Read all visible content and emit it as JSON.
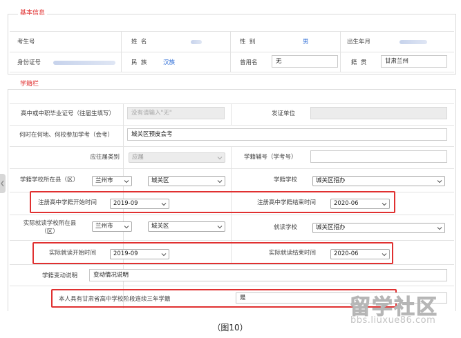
{
  "basic_info": {
    "legend": "基本信息",
    "exam_no_label": "考生号",
    "name_label": "姓  名",
    "gender_label": "性  别",
    "gender_value": "男",
    "birth_label": "出生年月",
    "id_label": "身份证号",
    "ethnicity_label": "民  族",
    "ethnicity_value": "汉族",
    "former_name_label": "曾用名",
    "former_name_value": "无",
    "native_place_label": "籍  贯",
    "native_place_value": "甘肃兰州"
  },
  "school_roll": {
    "legend": "学籍栏",
    "cert_no_label": "高中或中职毕业证号（往届生填写）",
    "cert_no_placeholder": "没有请输入\"无\"",
    "issuer_label": "发证单位",
    "exam_when_where_label": "何时在何地、何校参加学考（会考）",
    "exam_when_where_value": "城关区预皮会考",
    "grad_type_label": "应往届类别",
    "grad_type_value": "应届",
    "roll_no_label": "学籍辅号（学考号）",
    "roll_county_label": "学籍学校所在县（区）",
    "roll_city_value": "兰州市",
    "roll_district_value": "城关区",
    "roll_school_label": "学籍学校",
    "roll_school_value": "城关区招办",
    "reg_start_label": "注册高中学籍开始时间",
    "reg_start_value": "2019-09",
    "reg_end_label": "注册高中学籍结束时间",
    "reg_end_value": "2020-06",
    "actual_county_label": "实际就读学校所在县（区）",
    "actual_city_value": "兰州市",
    "actual_district_value": "城关区",
    "actual_school_label": "就读学校",
    "actual_school_value": "城关区招办",
    "actual_start_label": "实际就读开始时间",
    "actual_start_value": "2019-09",
    "actual_end_label": "实际就读结束时间",
    "actual_end_value": "2020-06",
    "change_label": "学籍变动说明",
    "change_value": "变动情况说明",
    "three_years_label": "本人具有甘肃省高中学校阶段连续三年学籍",
    "three_years_value": "是"
  },
  "watermark": {
    "brand": "留学社区",
    "url": "bbs.liuxue86.com"
  },
  "caption": "（图10）",
  "colors": {
    "accent_red": "#e03030",
    "link_blue": "#2a6bd6",
    "disabled_gray": "#ececec"
  }
}
